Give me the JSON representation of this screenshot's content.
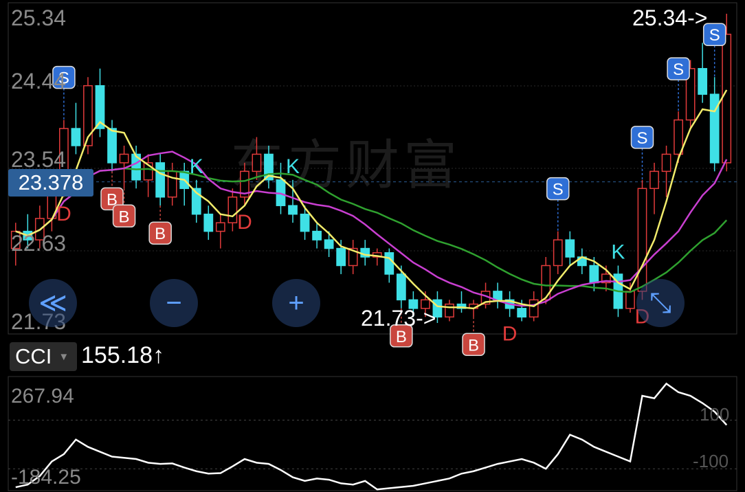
{
  "watermark": "东方财富",
  "price_axis": {
    "labels": [
      "25.34",
      "24.44",
      "23.54",
      "22.63",
      "21.73"
    ],
    "max": 25.34,
    "min": 21.73
  },
  "current_price": "23.378",
  "high_marker": "25.34->",
  "low_marker": "21.73->",
  "indicator": {
    "name": "CCI",
    "value": "155.18",
    "trend": "↑"
  },
  "cci_axis": {
    "top": "267.94",
    "bottom": "-184.25",
    "ref_upper": "100",
    "ref_lower": "-100"
  },
  "controls": [
    {
      "name": "scroll-left",
      "glyph": "≪"
    },
    {
      "name": "zoom-out",
      "glyph": "−"
    },
    {
      "name": "zoom-in",
      "glyph": "+"
    },
    {
      "name": "scroll-right",
      "glyph": "≫"
    },
    {
      "name": "reset",
      "glyph": "↺"
    },
    {
      "name": "fullscreen",
      "glyph": "⤡"
    }
  ],
  "colors": {
    "up": "#e23b3b",
    "down": "#3fe0e6",
    "ma_fast": "#f2ec6b",
    "ma_mid": "#c93fd1",
    "ma_slow": "#2fa12f",
    "sell": "#2f6fd6",
    "buy": "#c9463e"
  },
  "signals": [
    {
      "type": "S",
      "label": "S",
      "x_index": 4
    },
    {
      "type": "B",
      "label": "B",
      "x_index": 8
    },
    {
      "type": "B",
      "label": "B",
      "x_index": 9
    },
    {
      "type": "B",
      "label": "B",
      "x_index": 12
    },
    {
      "type": "B",
      "label": "B",
      "x_index": 32
    },
    {
      "type": "B",
      "label": "B",
      "x_index": 38
    },
    {
      "type": "S",
      "label": "S",
      "x_index": 45
    },
    {
      "type": "S",
      "label": "S",
      "x_index": 52
    },
    {
      "type": "S",
      "label": "S",
      "x_index": 55
    },
    {
      "type": "S",
      "label": "S",
      "x_index": 58
    }
  ],
  "kd_marks": [
    {
      "label": "D",
      "x_index": 4
    },
    {
      "label": "K",
      "x_index": 15
    },
    {
      "label": "D",
      "x_index": 19
    },
    {
      "label": "K",
      "x_index": 23
    },
    {
      "label": "D",
      "x_index": 41
    },
    {
      "label": "K",
      "x_index": 50
    },
    {
      "label": "D",
      "x_index": 52
    }
  ],
  "chart_data": {
    "type": "candlestick",
    "y_range": [
      21.73,
      25.34
    ],
    "candles": [
      {
        "o": 22.6,
        "h": 22.9,
        "l": 22.4,
        "c": 22.8
      },
      {
        "o": 22.8,
        "h": 23.0,
        "l": 22.6,
        "c": 22.7
      },
      {
        "o": 22.7,
        "h": 23.1,
        "l": 22.6,
        "c": 22.95
      },
      {
        "o": 22.95,
        "h": 23.4,
        "l": 22.8,
        "c": 23.3
      },
      {
        "o": 23.3,
        "h": 24.1,
        "l": 23.2,
        "c": 24.0
      },
      {
        "o": 24.0,
        "h": 24.3,
        "l": 23.7,
        "c": 23.8
      },
      {
        "o": 23.8,
        "h": 24.6,
        "l": 23.7,
        "c": 24.5
      },
      {
        "o": 24.5,
        "h": 24.7,
        "l": 23.9,
        "c": 24.0
      },
      {
        "o": 24.0,
        "h": 24.1,
        "l": 23.5,
        "c": 23.6
      },
      {
        "o": 23.6,
        "h": 23.8,
        "l": 23.3,
        "c": 23.7
      },
      {
        "o": 23.7,
        "h": 23.8,
        "l": 23.3,
        "c": 23.4
      },
      {
        "o": 23.4,
        "h": 23.7,
        "l": 23.2,
        "c": 23.6
      },
      {
        "o": 23.6,
        "h": 23.7,
        "l": 23.1,
        "c": 23.2
      },
      {
        "o": 23.2,
        "h": 23.6,
        "l": 23.1,
        "c": 23.5
      },
      {
        "o": 23.5,
        "h": 23.6,
        "l": 23.1,
        "c": 23.3
      },
      {
        "o": 23.3,
        "h": 23.4,
        "l": 22.9,
        "c": 23.0
      },
      {
        "o": 23.0,
        "h": 23.1,
        "l": 22.7,
        "c": 22.8
      },
      {
        "o": 22.8,
        "h": 23.0,
        "l": 22.6,
        "c": 22.9
      },
      {
        "o": 22.9,
        "h": 23.3,
        "l": 22.8,
        "c": 23.2
      },
      {
        "o": 23.2,
        "h": 23.6,
        "l": 23.1,
        "c": 23.5
      },
      {
        "o": 23.5,
        "h": 23.9,
        "l": 23.4,
        "c": 23.7
      },
      {
        "o": 23.7,
        "h": 23.8,
        "l": 23.3,
        "c": 23.4
      },
      {
        "o": 23.4,
        "h": 23.6,
        "l": 23.0,
        "c": 23.1
      },
      {
        "o": 23.1,
        "h": 23.4,
        "l": 22.9,
        "c": 23.0
      },
      {
        "o": 23.0,
        "h": 23.1,
        "l": 22.7,
        "c": 22.8
      },
      {
        "o": 22.8,
        "h": 22.9,
        "l": 22.6,
        "c": 22.7
      },
      {
        "o": 22.7,
        "h": 22.8,
        "l": 22.5,
        "c": 22.6
      },
      {
        "o": 22.6,
        "h": 22.7,
        "l": 22.3,
        "c": 22.4
      },
      {
        "o": 22.4,
        "h": 22.7,
        "l": 22.3,
        "c": 22.6
      },
      {
        "o": 22.6,
        "h": 22.7,
        "l": 22.4,
        "c": 22.5
      },
      {
        "o": 22.5,
        "h": 22.6,
        "l": 22.4,
        "c": 22.55
      },
      {
        "o": 22.55,
        "h": 22.6,
        "l": 22.2,
        "c": 22.3
      },
      {
        "o": 22.3,
        "h": 22.4,
        "l": 21.9,
        "c": 22.0
      },
      {
        "o": 22.0,
        "h": 22.1,
        "l": 21.8,
        "c": 21.9
      },
      {
        "o": 21.9,
        "h": 22.1,
        "l": 21.8,
        "c": 22.0
      },
      {
        "o": 22.0,
        "h": 22.1,
        "l": 21.73,
        "c": 21.8
      },
      {
        "o": 21.8,
        "h": 22.0,
        "l": 21.75,
        "c": 21.95
      },
      {
        "o": 21.95,
        "h": 22.1,
        "l": 21.85,
        "c": 21.9
      },
      {
        "o": 21.9,
        "h": 22.0,
        "l": 21.8,
        "c": 21.95
      },
      {
        "o": 21.95,
        "h": 22.2,
        "l": 21.9,
        "c": 22.1
      },
      {
        "o": 22.1,
        "h": 22.2,
        "l": 21.9,
        "c": 22.0
      },
      {
        "o": 22.0,
        "h": 22.1,
        "l": 21.8,
        "c": 21.9
      },
      {
        "o": 21.9,
        "h": 22.0,
        "l": 21.75,
        "c": 21.8
      },
      {
        "o": 21.8,
        "h": 22.1,
        "l": 21.75,
        "c": 22.0
      },
      {
        "o": 22.0,
        "h": 22.5,
        "l": 21.95,
        "c": 22.4
      },
      {
        "o": 22.4,
        "h": 22.8,
        "l": 22.3,
        "c": 22.7
      },
      {
        "o": 22.7,
        "h": 22.8,
        "l": 22.4,
        "c": 22.5
      },
      {
        "o": 22.5,
        "h": 22.6,
        "l": 22.3,
        "c": 22.4
      },
      {
        "o": 22.4,
        "h": 22.5,
        "l": 22.1,
        "c": 22.2
      },
      {
        "o": 22.2,
        "h": 22.4,
        "l": 22.1,
        "c": 22.3
      },
      {
        "o": 22.3,
        "h": 22.4,
        "l": 21.8,
        "c": 21.9
      },
      {
        "o": 21.9,
        "h": 22.2,
        "l": 21.85,
        "c": 22.1
      },
      {
        "o": 22.1,
        "h": 23.4,
        "l": 22.0,
        "c": 23.3
      },
      {
        "o": 23.3,
        "h": 23.6,
        "l": 23.0,
        "c": 23.5
      },
      {
        "o": 23.5,
        "h": 23.8,
        "l": 23.2,
        "c": 23.7
      },
      {
        "o": 23.7,
        "h": 24.2,
        "l": 23.6,
        "c": 24.1
      },
      {
        "o": 24.1,
        "h": 24.8,
        "l": 24.0,
        "c": 24.7
      },
      {
        "o": 24.7,
        "h": 25.0,
        "l": 24.3,
        "c": 24.4
      },
      {
        "o": 24.4,
        "h": 24.6,
        "l": 23.5,
        "c": 23.6
      },
      {
        "o": 23.6,
        "h": 25.34,
        "l": 23.5,
        "c": 25.1
      }
    ],
    "cci": [
      -176,
      -165,
      -130,
      -70,
      -40,
      20,
      -10,
      -30,
      -50,
      -55,
      -60,
      -75,
      -80,
      -78,
      -95,
      -110,
      -120,
      -118,
      -90,
      -60,
      -75,
      -80,
      -105,
      -135,
      -150,
      -140,
      -145,
      -160,
      -165,
      -150,
      -185,
      -180,
      -175,
      -170,
      -160,
      -150,
      -140,
      -120,
      -110,
      -95,
      -80,
      -70,
      -60,
      -75,
      -100,
      -40,
      40,
      20,
      -10,
      -30,
      -50,
      -70,
      200,
      190,
      250,
      215,
      200,
      170,
      135,
      80
    ],
    "cci_range": [
      -184.25,
      267.94
    ]
  }
}
